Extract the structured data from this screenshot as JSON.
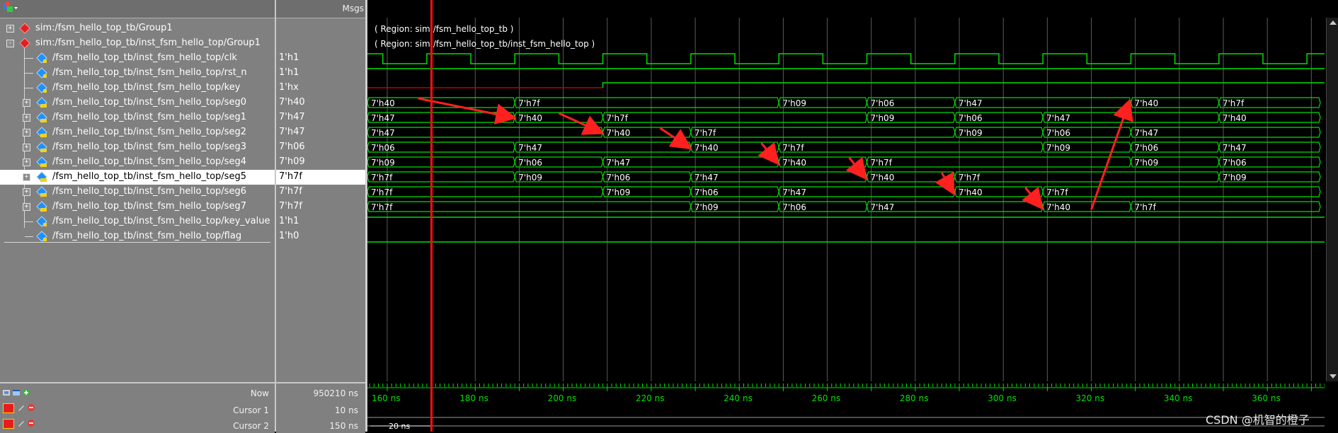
{
  "toolbar": {
    "msgs_label": "Msgs"
  },
  "signals": [
    {
      "name": "sim:/fsm_hello_top_tb/Group1",
      "value": "",
      "kind": "group",
      "expander": "+"
    },
    {
      "name": "sim:/fsm_hello_top_tb/inst_fsm_hello_top/Group1",
      "value": "",
      "kind": "group",
      "expander": "-"
    },
    {
      "name": "/fsm_hello_top_tb/inst_fsm_hello_top/clk",
      "value": "1'h1",
      "kind": "signal",
      "expander": ""
    },
    {
      "name": "/fsm_hello_top_tb/inst_fsm_hello_top/rst_n",
      "value": "1'h1",
      "kind": "signal",
      "expander": ""
    },
    {
      "name": "/fsm_hello_top_tb/inst_fsm_hello_top/key",
      "value": "1'hx",
      "kind": "signal",
      "expander": ""
    },
    {
      "name": "/fsm_hello_top_tb/inst_fsm_hello_top/seg0",
      "value": "7'h40",
      "kind": "bus",
      "expander": "+"
    },
    {
      "name": "/fsm_hello_top_tb/inst_fsm_hello_top/seg1",
      "value": "7'h47",
      "kind": "bus",
      "expander": "+"
    },
    {
      "name": "/fsm_hello_top_tb/inst_fsm_hello_top/seg2",
      "value": "7'h47",
      "kind": "bus",
      "expander": "+"
    },
    {
      "name": "/fsm_hello_top_tb/inst_fsm_hello_top/seg3",
      "value": "7'h06",
      "kind": "bus",
      "expander": "+"
    },
    {
      "name": "/fsm_hello_top_tb/inst_fsm_hello_top/seg4",
      "value": "7'h09",
      "kind": "bus",
      "expander": "+"
    },
    {
      "name": "/fsm_hello_top_tb/inst_fsm_hello_top/seg5",
      "value": "7'h7f",
      "kind": "bus",
      "expander": "+",
      "selected": true
    },
    {
      "name": "/fsm_hello_top_tb/inst_fsm_hello_top/seg6",
      "value": "7'h7f",
      "kind": "bus",
      "expander": "+"
    },
    {
      "name": "/fsm_hello_top_tb/inst_fsm_hello_top/seg7",
      "value": "7'h7f",
      "kind": "bus",
      "expander": "+"
    },
    {
      "name": "/fsm_hello_top_tb/inst_fsm_hello_top/key_value",
      "value": "1'h1",
      "kind": "signal",
      "expander": ""
    },
    {
      "name": "/fsm_hello_top_tb/inst_fsm_hello_top/flag",
      "value": "1'h0",
      "kind": "signal",
      "expander": ""
    }
  ],
  "regions": [
    "( Region: sim:/fsm_hello_top_tb )",
    "( Region: sim:/fsm_hello_top_tb/inst_fsm_hello_top )"
  ],
  "timeline": {
    "labels": [
      "160 ns",
      "180 ns",
      "200 ns",
      "220 ns",
      "240 ns",
      "260 ns",
      "280 ns",
      "300 ns",
      "320 ns",
      "340 ns",
      "360 ns"
    ],
    "t_start_ns": 155.5,
    "t_end_ns": 373,
    "cursor_ns": 170,
    "delta_label": "20 ns",
    "delta_ns": 20
  },
  "cursors": [
    {
      "label": "Now",
      "value": "950210 ns"
    },
    {
      "label": "Cursor 1",
      "value": "10 ns"
    },
    {
      "label": "Cursor 2",
      "value": "150 ns"
    }
  ],
  "bus_values": [
    [
      [
        155.5,
        "7'h40"
      ],
      [
        189,
        "7'h7f"
      ],
      [
        249,
        "7'h09"
      ],
      [
        269,
        "7'h06"
      ],
      [
        289,
        "7'h47"
      ],
      [
        329,
        "7'h40"
      ],
      [
        349,
        "7'h7f"
      ]
    ],
    [
      [
        155.5,
        "7'h47"
      ],
      [
        189,
        "7'h40"
      ],
      [
        209,
        "7'h7f"
      ],
      [
        269,
        "7'h09"
      ],
      [
        289,
        "7'h06"
      ],
      [
        309,
        "7'h47"
      ],
      [
        349,
        "7'h40"
      ]
    ],
    [
      [
        155.5,
        "7'h47"
      ],
      [
        209,
        "7'h40"
      ],
      [
        229,
        "7'h7f"
      ],
      [
        289,
        "7'h09"
      ],
      [
        309,
        "7'h06"
      ],
      [
        329,
        "7'h47"
      ]
    ],
    [
      [
        155.5,
        "7'h06"
      ],
      [
        189,
        "7'h47"
      ],
      [
        229,
        "7'h40"
      ],
      [
        249,
        "7'h7f"
      ],
      [
        309,
        "7'h09"
      ],
      [
        329,
        "7'h06"
      ],
      [
        349,
        "7'h47"
      ]
    ],
    [
      [
        155.5,
        "7'h09"
      ],
      [
        189,
        "7'h06"
      ],
      [
        209,
        "7'h47"
      ],
      [
        249,
        "7'h40"
      ],
      [
        269,
        "7'h7f"
      ],
      [
        329,
        "7'h09"
      ],
      [
        349,
        "7'h06"
      ]
    ],
    [
      [
        155.5,
        "7'h7f"
      ],
      [
        189,
        "7'h09"
      ],
      [
        209,
        "7'h06"
      ],
      [
        229,
        "7'h47"
      ],
      [
        269,
        "7'h40"
      ],
      [
        289,
        "7'h7f"
      ],
      [
        349,
        "7'h09"
      ]
    ],
    [
      [
        155.5,
        "7'h7f"
      ],
      [
        209,
        "7'h09"
      ],
      [
        229,
        "7'h06"
      ],
      [
        249,
        "7'h47"
      ],
      [
        289,
        "7'h40"
      ],
      [
        309,
        "7'h7f"
      ]
    ],
    [
      [
        155.5,
        "7'h7f"
      ],
      [
        229,
        "7'h09"
      ],
      [
        249,
        "7'h06"
      ],
      [
        269,
        "7'h47"
      ],
      [
        309,
        "7'h40"
      ],
      [
        329,
        "7'h7f"
      ]
    ]
  ],
  "colors": {
    "wave": "#00e000",
    "cursor": "#ff1010",
    "annotation_arrow": "#ff2020",
    "key_unknown": "#c00000"
  },
  "watermark": "CSDN @机智的橙子"
}
